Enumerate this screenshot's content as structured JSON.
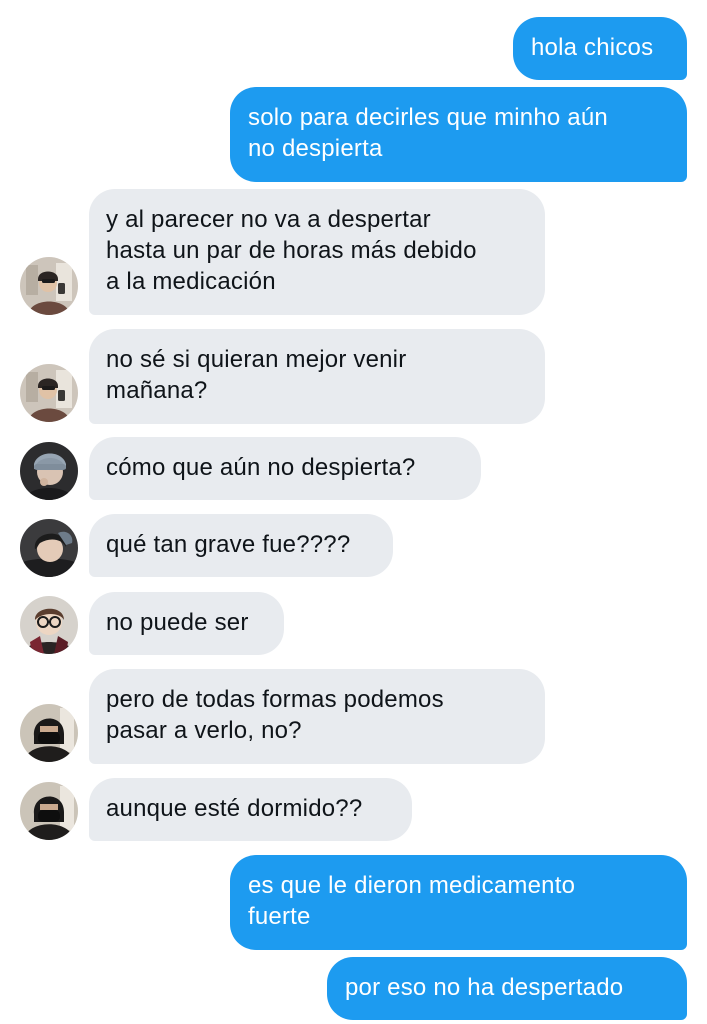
{
  "messages": [
    {
      "direction": "outgoing",
      "text": "hola chicos"
    },
    {
      "direction": "outgoing",
      "text": "solo para decirles que minho aún\nno despierta"
    },
    {
      "direction": "incoming",
      "text": "y al parecer no va a despertar\nhasta un par de horas más debido\na la medicación",
      "avatar": "avatar-mirror-selfie-icon"
    },
    {
      "direction": "incoming",
      "text": "no sé si quieran mejor venir\nmañana?",
      "avatar": "avatar-mirror-selfie-icon"
    },
    {
      "direction": "incoming",
      "text": "cómo que aún no despierta?",
      "avatar": "avatar-beanie-icon"
    },
    {
      "direction": "incoming",
      "text": "qué tan grave fue????",
      "avatar": "avatar-dark-hair-icon"
    },
    {
      "direction": "incoming",
      "text": "no puede ser",
      "avatar": "avatar-glasses-icon"
    },
    {
      "direction": "incoming",
      "text": "pero de todas formas podemos\npasar a verlo, no?",
      "avatar": "avatar-mask-icon"
    },
    {
      "direction": "incoming",
      "text": "aunque esté dormido??",
      "avatar": "avatar-mask-icon"
    },
    {
      "direction": "outgoing",
      "text": "es que le dieron medicamento\nfuerte"
    },
    {
      "direction": "outgoing",
      "text": "por eso no ha despertado"
    }
  ],
  "colors": {
    "outgoing_bubble": "#1d9bf0",
    "outgoing_text": "#ffffff",
    "incoming_bubble": "#e8ebef",
    "incoming_text": "#0f1419",
    "background": "#ffffff"
  }
}
